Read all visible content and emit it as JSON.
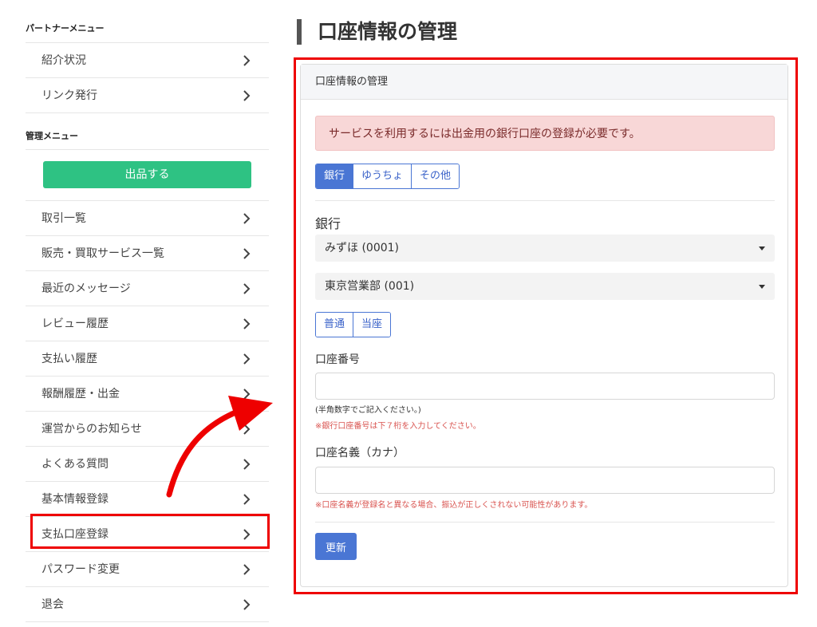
{
  "sidebar": {
    "partner_heading": "パートナーメニュー",
    "partner_items": [
      {
        "label": "紹介状況"
      },
      {
        "label": "リンク発行"
      }
    ],
    "admin_heading": "管理メニュー",
    "sell_button": "出品する",
    "admin_items": [
      {
        "label": "取引一覧"
      },
      {
        "label": "販売・買取サービス一覧"
      },
      {
        "label": "最近のメッセージ"
      },
      {
        "label": "レビュー履歴"
      },
      {
        "label": "支払い履歴"
      },
      {
        "label": "報酬履歴・出金"
      },
      {
        "label": "運営からのお知らせ"
      },
      {
        "label": "よくある質問"
      },
      {
        "label": "基本情報登録"
      },
      {
        "label": "支払口座登録"
      },
      {
        "label": "パスワード変更"
      },
      {
        "label": "退会"
      }
    ],
    "highlighted_item": "支払口座登録"
  },
  "main": {
    "page_title": "口座情報の管理",
    "card_title": "口座情報の管理",
    "alert": "サービスを利用するには出金用の銀行口座の登録が必要です。",
    "account_type_tabs": [
      {
        "label": "銀行",
        "active": true
      },
      {
        "label": "ゆうちょ",
        "active": false
      },
      {
        "label": "その他",
        "active": false
      }
    ],
    "bank_label": "銀行",
    "bank_select": "みずほ (0001)",
    "branch_select": "東京営業部 (001)",
    "deposit_type_tabs": [
      {
        "label": "普通",
        "active": false
      },
      {
        "label": "当座",
        "active": false
      }
    ],
    "account_number_label": "口座番号",
    "account_number_value": "",
    "account_number_help": "(半角数字でご記入ください。)",
    "account_number_warning": "※銀行口座番号は下７桁を入力してください。",
    "account_name_label": "口座名義（カナ）",
    "account_name_value": "",
    "account_name_warning": "※口座名義が登録名と異なる場合、振込が正しくされない可能性があります。",
    "submit_label": "更新"
  },
  "colors": {
    "accent_blue": "#4a76d4",
    "sell_green": "#2ec283",
    "highlight_red": "#e00000",
    "alert_bg": "#f8d7d7",
    "warning_text": "#d9534f"
  }
}
